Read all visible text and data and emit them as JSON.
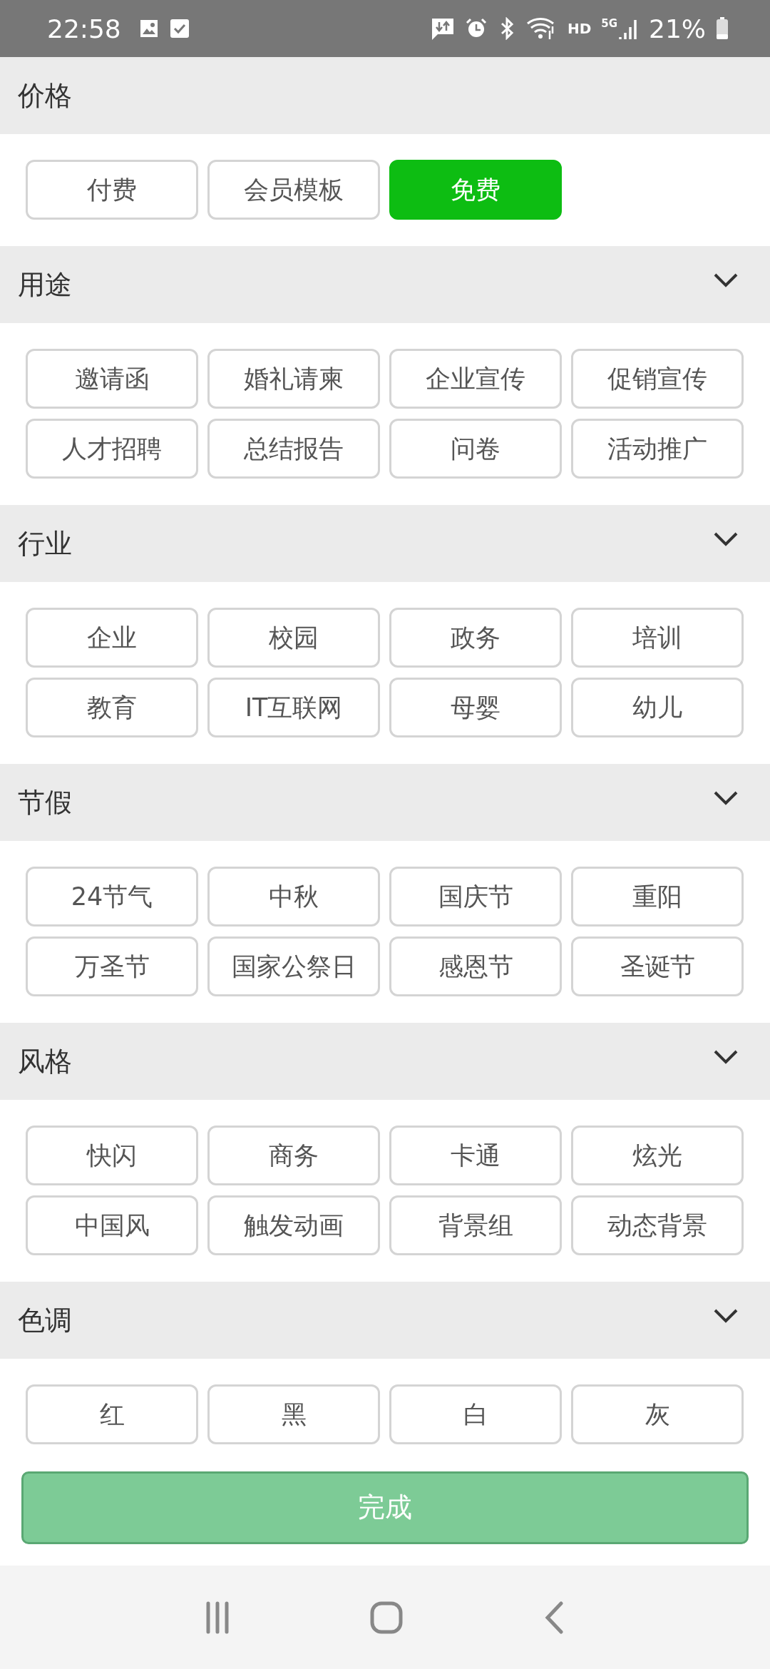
{
  "status_bar": {
    "time": "22:58",
    "network": "5G",
    "hd": "HD",
    "battery": "21%"
  },
  "sections": [
    {
      "title": "价格",
      "collapsible": false,
      "chips": [
        {
          "label": "付费",
          "selected": false
        },
        {
          "label": "会员模板",
          "selected": false
        },
        {
          "label": "免费",
          "selected": true
        }
      ]
    },
    {
      "title": "用途",
      "collapsible": true,
      "chips": [
        {
          "label": "邀请函",
          "selected": false
        },
        {
          "label": "婚礼请柬",
          "selected": false
        },
        {
          "label": "企业宣传",
          "selected": false
        },
        {
          "label": "促销宣传",
          "selected": false
        },
        {
          "label": "人才招聘",
          "selected": false
        },
        {
          "label": "总结报告",
          "selected": false
        },
        {
          "label": "问卷",
          "selected": false
        },
        {
          "label": "活动推广",
          "selected": false
        }
      ]
    },
    {
      "title": "行业",
      "collapsible": true,
      "chips": [
        {
          "label": "企业",
          "selected": false
        },
        {
          "label": "校园",
          "selected": false
        },
        {
          "label": "政务",
          "selected": false
        },
        {
          "label": "培训",
          "selected": false
        },
        {
          "label": "教育",
          "selected": false
        },
        {
          "label": "IT互联网",
          "selected": false
        },
        {
          "label": "母婴",
          "selected": false
        },
        {
          "label": "幼儿",
          "selected": false
        }
      ]
    },
    {
      "title": "节假",
      "collapsible": true,
      "chips": [
        {
          "label": "24节气",
          "selected": false
        },
        {
          "label": "中秋",
          "selected": false
        },
        {
          "label": "国庆节",
          "selected": false
        },
        {
          "label": "重阳",
          "selected": false
        },
        {
          "label": "万圣节",
          "selected": false
        },
        {
          "label": "国家公祭日",
          "selected": false
        },
        {
          "label": "感恩节",
          "selected": false
        },
        {
          "label": "圣诞节",
          "selected": false
        }
      ]
    },
    {
      "title": "风格",
      "collapsible": true,
      "chips": [
        {
          "label": "快闪",
          "selected": false
        },
        {
          "label": "商务",
          "selected": false
        },
        {
          "label": "卡通",
          "selected": false
        },
        {
          "label": "炫光",
          "selected": false
        },
        {
          "label": "中国风",
          "selected": false
        },
        {
          "label": "触发动画",
          "selected": false
        },
        {
          "label": "背景组",
          "selected": false
        },
        {
          "label": "动态背景",
          "selected": false
        }
      ]
    },
    {
      "title": "色调",
      "collapsible": true,
      "chips": [
        {
          "label": "红",
          "selected": false
        },
        {
          "label": "黑",
          "selected": false
        },
        {
          "label": "白",
          "selected": false
        },
        {
          "label": "灰",
          "selected": false
        }
      ]
    }
  ],
  "done_button": "完成"
}
